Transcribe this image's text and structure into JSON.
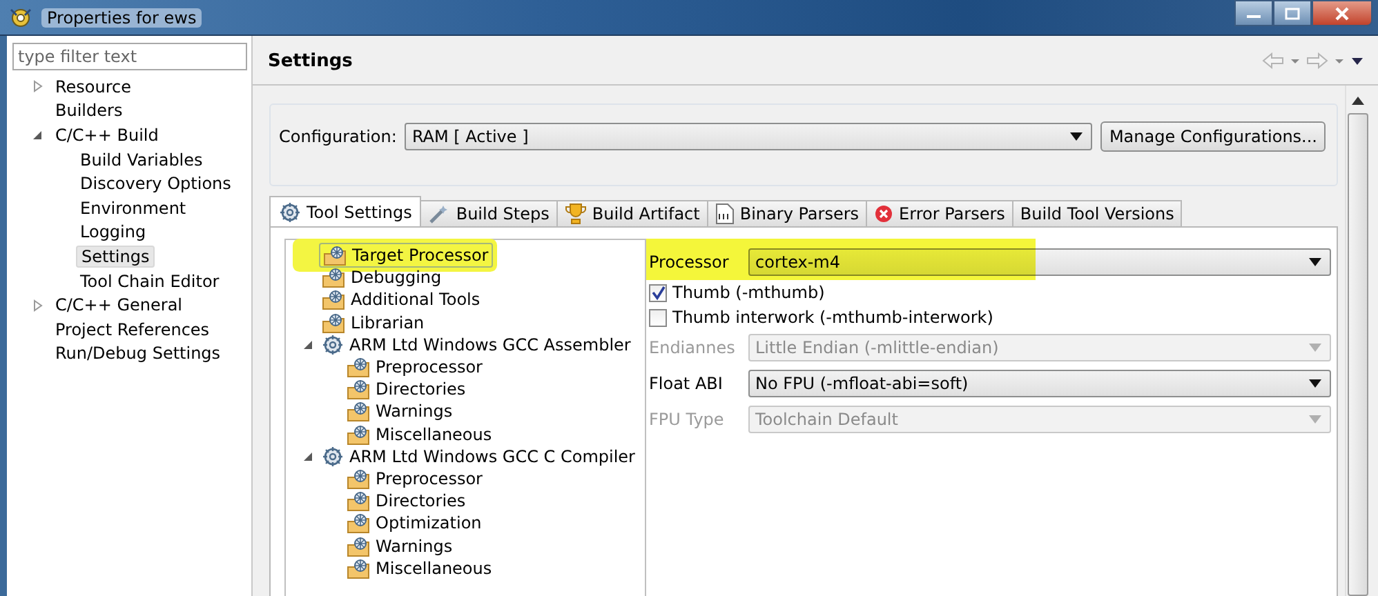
{
  "window": {
    "title": "Properties for ews"
  },
  "filter": {
    "placeholder": "type filter text"
  },
  "nav_tree": [
    {
      "label": "Resource",
      "expanded": false,
      "selected": false
    },
    {
      "label": "Builders",
      "selected": false
    },
    {
      "label": "C/C++ Build",
      "expanded": true,
      "selected": false,
      "children": [
        {
          "label": "Build Variables",
          "selected": false
        },
        {
          "label": "Discovery Options",
          "selected": false
        },
        {
          "label": "Environment",
          "selected": false
        },
        {
          "label": "Logging",
          "selected": false
        },
        {
          "label": "Settings",
          "selected": true
        },
        {
          "label": "Tool Chain Editor",
          "selected": false
        }
      ]
    },
    {
      "label": "C/C++ General",
      "expanded": false,
      "selected": false
    },
    {
      "label": "Project References",
      "selected": false
    },
    {
      "label": "Run/Debug Settings",
      "selected": false
    }
  ],
  "page": {
    "title": "Settings"
  },
  "configuration": {
    "label": "Configuration:",
    "value": "RAM  [ Active ]",
    "button": "Manage Configurations..."
  },
  "tabs": [
    {
      "label": "Tool Settings",
      "kind": "gear",
      "selected": true
    },
    {
      "label": "Build Steps",
      "kind": "wand",
      "selected": false
    },
    {
      "label": "Build Artifact",
      "kind": "trophy",
      "selected": false
    },
    {
      "label": "Binary Parsers",
      "kind": "binary",
      "selected": false
    },
    {
      "label": "Error Parsers",
      "kind": "error",
      "selected": false
    },
    {
      "label": "Build Tool Versions",
      "kind": "none",
      "selected": false
    }
  ],
  "tool_tree": [
    {
      "label": "Target Processor",
      "kind": "tool",
      "selected": true,
      "highlighted": true
    },
    {
      "label": "Debugging",
      "kind": "tool",
      "selected": false
    },
    {
      "label": "Additional Tools",
      "kind": "tool",
      "selected": false
    },
    {
      "label": "Librarian",
      "kind": "tool",
      "selected": false
    },
    {
      "label": "ARM Ltd Windows GCC Assembler",
      "kind": "toolchain",
      "expanded": true,
      "selected": false,
      "children": [
        {
          "label": "Preprocessor",
          "kind": "tool",
          "selected": false
        },
        {
          "label": "Directories",
          "kind": "tool",
          "selected": false
        },
        {
          "label": "Warnings",
          "kind": "tool",
          "selected": false
        },
        {
          "label": "Miscellaneous",
          "kind": "tool",
          "selected": false
        }
      ]
    },
    {
      "label": "ARM Ltd Windows GCC C Compiler",
      "kind": "toolchain",
      "expanded": true,
      "selected": false,
      "children": [
        {
          "label": "Preprocessor",
          "kind": "tool",
          "selected": false
        },
        {
          "label": "Directories",
          "kind": "tool",
          "selected": false
        },
        {
          "label": "Optimization",
          "kind": "tool",
          "selected": false
        },
        {
          "label": "Warnings",
          "kind": "tool",
          "selected": false
        },
        {
          "label": "Miscellaneous",
          "kind": "tool",
          "selected": false
        }
      ]
    }
  ],
  "options": [
    {
      "kind": "combo",
      "label": "Processor",
      "value": "cortex-m4",
      "disabled": false,
      "highlighted": true
    },
    {
      "kind": "checkbox",
      "label": "Thumb (-mthumb)",
      "checked": true
    },
    {
      "kind": "checkbox",
      "label": "Thumb interwork (-mthumb-interwork)",
      "checked": false
    },
    {
      "kind": "combo",
      "label": "Endiannes",
      "value": "Little Endian (-mlittle-endian)",
      "disabled": true
    },
    {
      "kind": "combo",
      "label": "Float ABI",
      "value": "No FPU (-mfloat-abi=soft)",
      "disabled": false
    },
    {
      "kind": "combo",
      "label": "FPU Type",
      "value": "Toolchain Default",
      "disabled": true
    }
  ]
}
